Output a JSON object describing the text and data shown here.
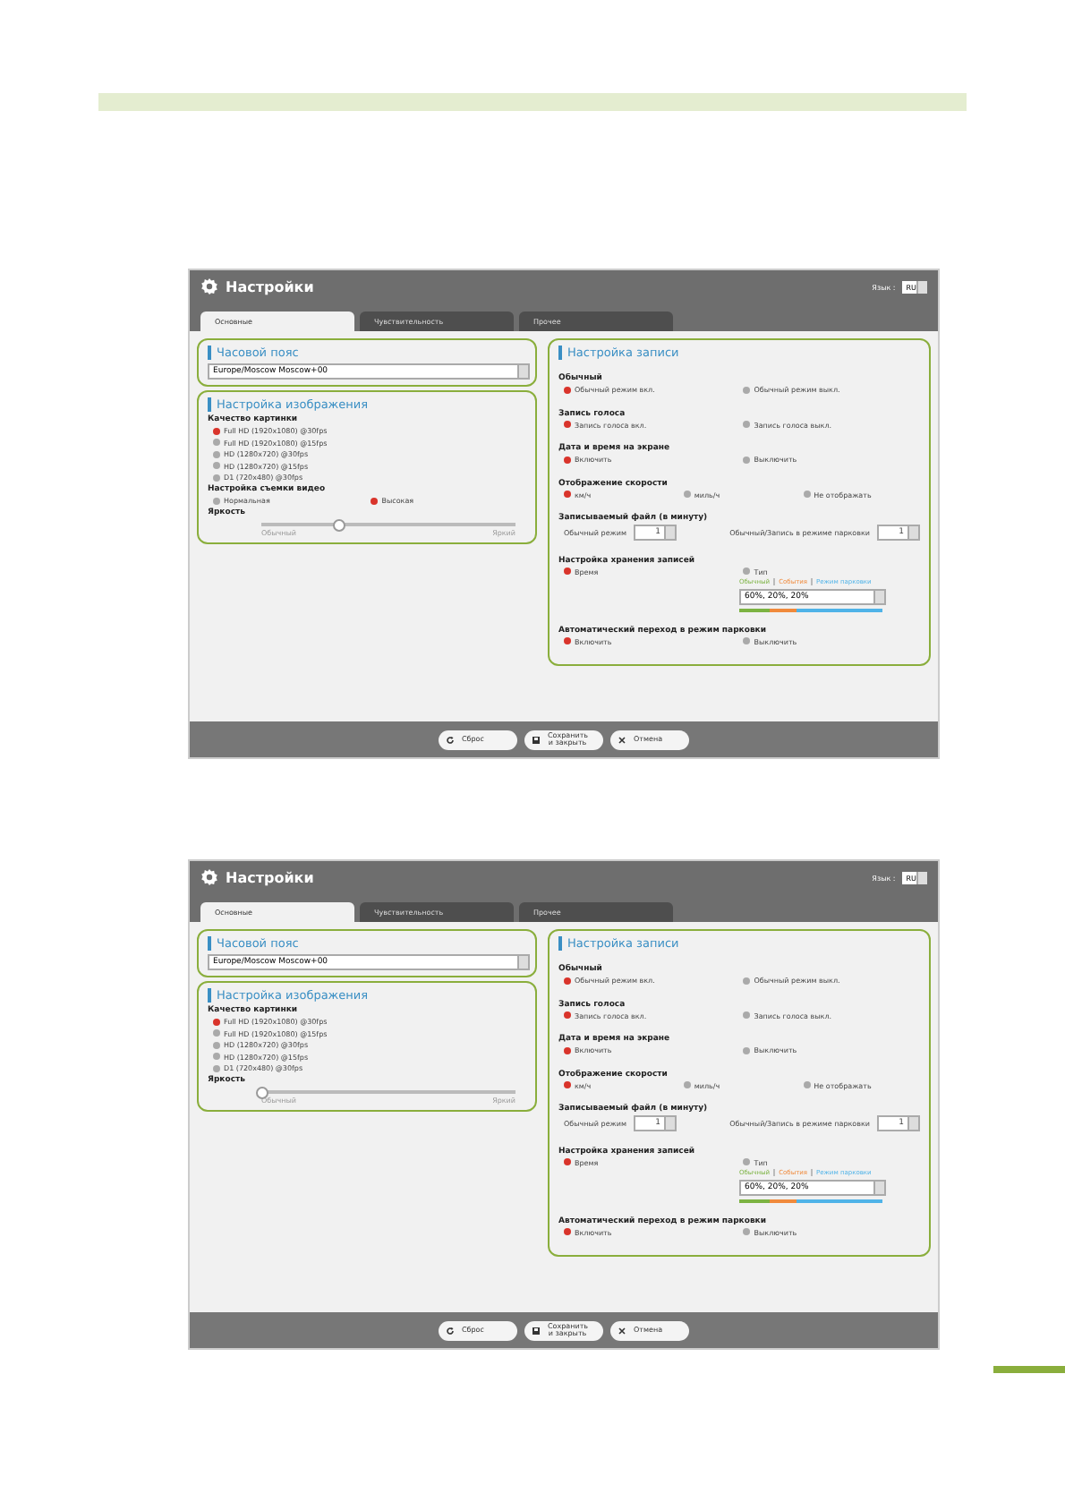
{
  "screens": [
    {
      "title": "Настройки",
      "lang_label": "Язык :",
      "lang_value": "RU",
      "tabs": [
        {
          "label": "Основные",
          "selected": true
        },
        {
          "label": "Чувствительность",
          "selected": false
        },
        {
          "label": "Прочее",
          "selected": false
        }
      ],
      "timezone": {
        "title": "Часовой пояс",
        "value": "Europe/Moscow Moscow+00"
      },
      "image": {
        "title": "Настройка изображения",
        "groups": [
          {
            "kind": "radio_list",
            "label": "Качество картинки",
            "options": [
              {
                "label": "Full HD (1920x1080) @30fps",
                "selected": true
              },
              {
                "label": "Full HD (1920x1080) @15fps",
                "selected": false
              },
              {
                "label": "HD (1280x720) @30fps",
                "selected": false
              },
              {
                "label": "HD (1280x720) @15fps",
                "selected": false
              },
              {
                "label": "D1 (720x480) @30fps",
                "selected": false
              }
            ]
          },
          {
            "kind": "radio",
            "label": "Настройка съемки видео",
            "options": [
              {
                "label": "Нормальная",
                "selected": false
              },
              {
                "label": "Высокая",
                "selected": true
              }
            ]
          },
          {
            "kind": "slider",
            "label": "Яркость",
            "min_label": "Обычный",
            "max_label": "Яркий",
            "level": 0.3
          }
        ]
      },
      "record": {
        "title": "Настройка записи",
        "groups": [
          {
            "kind": "radio",
            "label": "Обычный",
            "options": [
              {
                "label": "Обычный режим вкл.",
                "selected": true
              },
              {
                "label": "Обычный режим выкл.",
                "selected": false
              }
            ]
          },
          {
            "kind": "radio",
            "label": "Запись голоса",
            "options": [
              {
                "label": "Запись голоса вкл.",
                "selected": true
              },
              {
                "label": "Запись голоса выкл.",
                "selected": false
              }
            ]
          },
          {
            "kind": "radio",
            "label": "Дата и время на экране",
            "options": [
              {
                "label": "Включить",
                "selected": true
              },
              {
                "label": "Выключить",
                "selected": false
              }
            ]
          },
          {
            "kind": "radio",
            "label": "Отображение скорости",
            "options": [
              {
                "label": "км/ч",
                "selected": true
              },
              {
                "label": "миль/ч",
                "selected": false
              },
              {
                "label": "Не отображать",
                "selected": false
              }
            ]
          },
          {
            "kind": "selects",
            "label": "**Записываемый файл** (в минуту)",
            "items": [
              {
                "label": "Обычный режим",
                "value": "1"
              },
              {
                "label": "Обычный/Запись в режиме парковки",
                "value": "1"
              }
            ]
          },
          {
            "kind": "storage",
            "label": "Настройка хранения записей",
            "options": [
              {
                "label": "Время",
                "selected": true
              },
              {
                "label": "Тип",
                "selected": false
              }
            ],
            "legend": [
              {
                "label": "Обычный",
                "color": "#7cb342"
              },
              {
                "label": "События",
                "color": "#f08a3c"
              },
              {
                "label": "Режим парковки",
                "color": "#4fb3e8"
              }
            ],
            "value": "60%, 20%, 20%"
          },
          {
            "kind": "radio",
            "label": "Автоматический переход в режим парковки",
            "options": [
              {
                "label": "Включить",
                "selected": true
              },
              {
                "label": "Выключить",
                "selected": false
              }
            ]
          }
        ]
      },
      "buttons": [
        {
          "kind": "reset",
          "label": "Сброс"
        },
        {
          "kind": "save",
          "label": "Сохранить и закрыть"
        },
        {
          "kind": "cancel",
          "label": "Отмена"
        }
      ]
    },
    {
      "title": "Настройки",
      "lang_label": "Язык :",
      "lang_value": "RU",
      "tabs": [
        {
          "label": "Основные",
          "selected": true
        },
        {
          "label": "Чувствительность",
          "selected": false
        },
        {
          "label": "Прочее",
          "selected": false
        }
      ],
      "timezone": {
        "title": "Часовой пояс",
        "value": "Europe/Moscow Moscow+00"
      },
      "image": {
        "title": "Настройка изображения",
        "groups": [
          {
            "kind": "radio_list",
            "label": "Качество картинки",
            "options": [
              {
                "label": "Full HD (1920x1080) @30fps",
                "selected": true
              },
              {
                "label": "Full HD (1920x1080) @15fps",
                "selected": false
              },
              {
                "label": "HD (1280x720) @30fps",
                "selected": false
              },
              {
                "label": "HD (1280x720) @15fps",
                "selected": false
              },
              {
                "label": "D1 (720x480) @30fps",
                "selected": false
              }
            ]
          },
          {
            "kind": "slider",
            "label": "Яркость",
            "min_label": "Обычный",
            "max_label": "Яркий",
            "level": 0
          }
        ]
      },
      "record": {
        "title": "Настройка записи",
        "groups": [
          {
            "kind": "radio",
            "label": "Обычный",
            "options": [
              {
                "label": "Обычный режим вкл.",
                "selected": true
              },
              {
                "label": "Обычный режим выкл.",
                "selected": false
              }
            ]
          },
          {
            "kind": "radio",
            "label": "Запись голоса",
            "options": [
              {
                "label": "Запись голоса вкл.",
                "selected": true
              },
              {
                "label": "Запись голоса выкл.",
                "selected": false
              }
            ]
          },
          {
            "kind": "radio",
            "label": "Дата и время на экране",
            "options": [
              {
                "label": "Включить",
                "selected": true
              },
              {
                "label": "Выключить",
                "selected": false
              }
            ]
          },
          {
            "kind": "radio",
            "label": "Отображение скорости",
            "options": [
              {
                "label": "км/ч",
                "selected": true
              },
              {
                "label": "миль/ч",
                "selected": false
              },
              {
                "label": "Не отображать",
                "selected": false
              }
            ]
          },
          {
            "kind": "selects",
            "label": "**Записываемый файл** (в минуту)",
            "items": [
              {
                "label": "Обычный режим",
                "value": "1"
              },
              {
                "label": "Обычный/Запись в режиме парковки",
                "value": "1"
              }
            ]
          },
          {
            "kind": "storage",
            "label": "Настройка хранения записей",
            "options": [
              {
                "label": "Время",
                "selected": true
              },
              {
                "label": "Тип",
                "selected": false
              }
            ],
            "legend": [
              {
                "label": "Обычный",
                "color": "#7cb342"
              },
              {
                "label": "События",
                "color": "#f08a3c"
              },
              {
                "label": "Режим парковки",
                "color": "#4fb3e8"
              }
            ],
            "value": "60%, 20%, 20%"
          },
          {
            "kind": "radio",
            "label": "Автоматический переход в режим парковки",
            "options": [
              {
                "label": "Включить",
                "selected": true
              },
              {
                "label": "Выключить",
                "selected": false
              }
            ]
          }
        ]
      },
      "buttons": [
        {
          "kind": "reset",
          "label": "Сброс"
        },
        {
          "kind": "save",
          "label": "Сохранить и закрыть"
        },
        {
          "kind": "cancel",
          "label": "Отмена"
        }
      ]
    }
  ]
}
